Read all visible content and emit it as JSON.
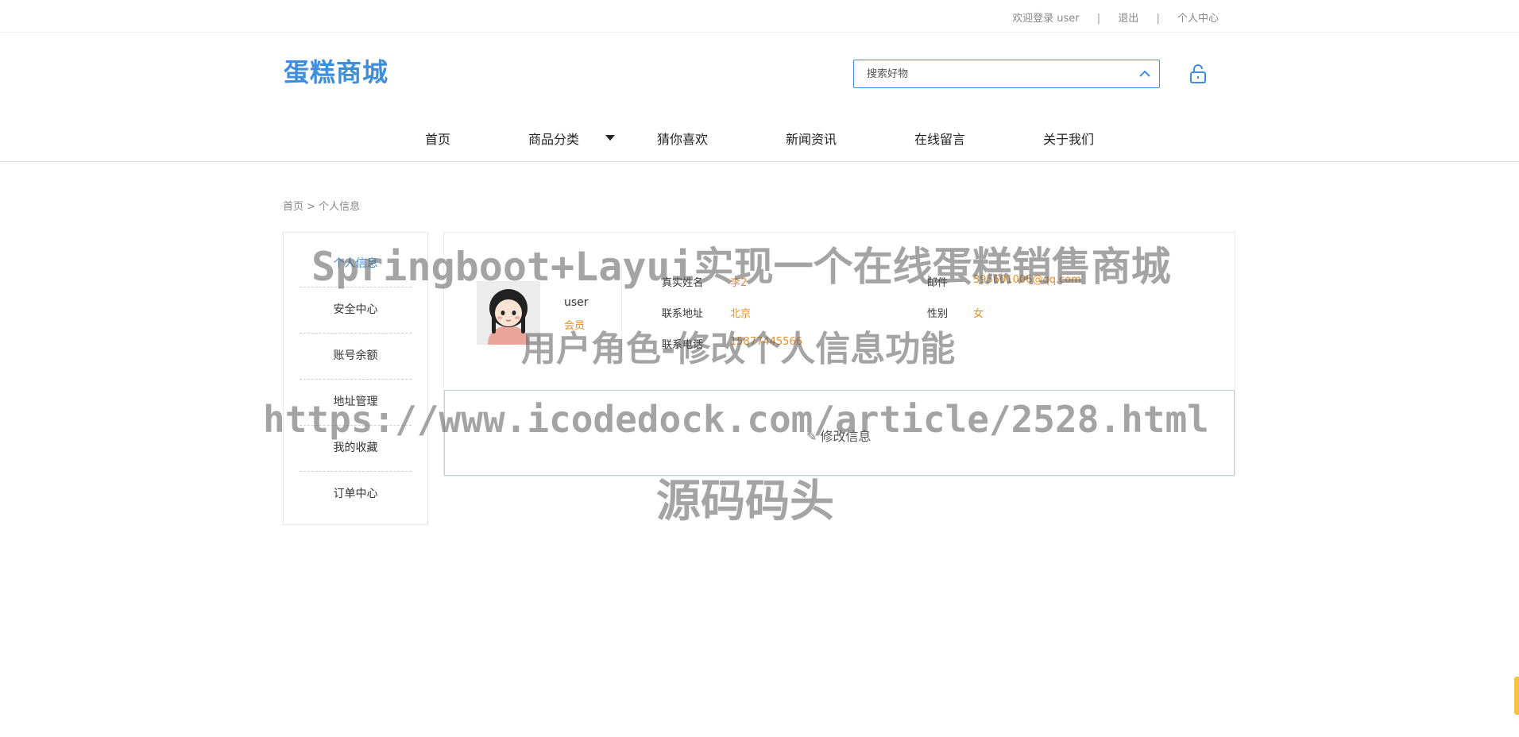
{
  "topbar": {
    "welcome": "欢迎登录 user",
    "separator": "|",
    "logout": "退出",
    "personal_center": "个人中心"
  },
  "header": {
    "logo": "蛋糕商城",
    "search_placeholder": "搜索好物",
    "icons": {
      "search_toggle": "chevron-up-icon",
      "login": "unlock-icon"
    },
    "accent_color": "#3e8ede"
  },
  "nav": {
    "items": [
      "首页",
      "商品分类",
      "猜你喜欢",
      "新闻资讯",
      "在线留言",
      "关于我们"
    ]
  },
  "breadcrumb": "首页 > 个人信息",
  "sidebar": {
    "items": [
      "个人信息",
      "安全中心",
      "账号余额",
      "地址管理",
      "我的收藏",
      "订单中心"
    ],
    "active_index": 0
  },
  "profile": {
    "username": "user",
    "role": "会员",
    "fields": {
      "real_name_label": "真实姓名",
      "real_name": "李2",
      "email_label": "邮件",
      "email": "395601006@qq.com",
      "address_label": "联系地址",
      "address": "北京",
      "gender_label": "性别",
      "gender": "女",
      "phone_label": "联系电话",
      "phone": "15877445566"
    },
    "edit_label": "修改信息",
    "value_color": "#e88e28"
  },
  "watermark": {
    "line1": "Springboot+Layui实现一个在线蛋糕销售商城",
    "line2": "用户角色-修改个人信息功能",
    "line3": "https://www.icodedock.com/article/2528.html",
    "line4": "源码码头"
  }
}
